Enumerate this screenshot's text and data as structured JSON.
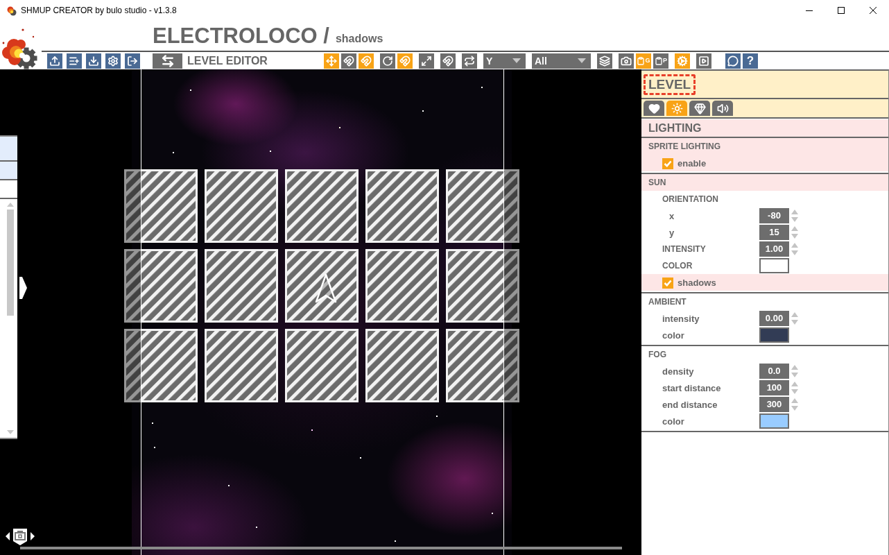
{
  "window": {
    "title": "SHMUP CREATOR by bulo studio - v1.3.8"
  },
  "header": {
    "title": "ELECTROLOCO /",
    "subtitle": "shadows"
  },
  "toolbar": {
    "mode_label": "LEVEL EDITOR",
    "tool_groups": [
      [
        {
          "kind": "button",
          "on": true
        },
        {
          "kind": "button",
          "on": false
        },
        {
          "kind": "button",
          "on": true
        }
      ],
      [
        {
          "kind": "button",
          "on": false
        },
        {
          "kind": "button",
          "on": true
        }
      ],
      [
        {
          "kind": "button",
          "on": false
        }
      ],
      [
        {
          "kind": "button",
          "on": false
        }
      ],
      [
        {
          "kind": "button",
          "on": false
        }
      ],
      [
        {
          "kind": "dropdown",
          "value": "Y"
        }
      ],
      [
        {
          "kind": "dropdown",
          "value": "All"
        }
      ],
      [
        {
          "kind": "button",
          "on": false
        }
      ],
      [
        {
          "kind": "button",
          "on": false
        },
        {
          "kind": "button",
          "on": true,
          "label": "G"
        },
        {
          "kind": "button",
          "on": false,
          "label": "P"
        }
      ],
      [
        {
          "kind": "button",
          "on": true
        }
      ],
      [
        {
          "kind": "button",
          "on": false
        }
      ]
    ],
    "help_label": "?"
  },
  "canvas": {
    "side_list": [
      {
        "selected": true
      },
      {
        "selected": true
      },
      {
        "selected": false
      }
    ]
  },
  "inspector": {
    "title": "LEVEL",
    "tabs": [
      {
        "selected": false
      },
      {
        "selected": true
      },
      {
        "selected": false
      },
      {
        "selected": false
      }
    ],
    "section": "LIGHTING",
    "groups": [
      {
        "title": "SPRITE LIGHTING",
        "highlighted": true,
        "rows": [
          {
            "kind": "checkbox",
            "label": "enable",
            "checked": true
          }
        ]
      },
      {
        "title": "SUN",
        "highlighted": true,
        "rows": [
          {
            "kind": "heading",
            "label": "ORIENTATION",
            "children": [
              {
                "kind": "number",
                "label": "x",
                "value": "-80"
              },
              {
                "kind": "number",
                "label": "y",
                "value": "15"
              }
            ]
          },
          {
            "kind": "number",
            "label": "INTENSITY",
            "value": "1.00"
          },
          {
            "kind": "color",
            "label": "COLOR",
            "color": "#ffffff"
          },
          {
            "kind": "checkbox",
            "label": "shadows",
            "checked": true
          }
        ]
      },
      {
        "title": "AMBIENT",
        "highlighted": false,
        "rows": [
          {
            "kind": "number",
            "label": "intensity",
            "value": "0.00"
          },
          {
            "kind": "color",
            "label": "color",
            "color": "#323c55"
          }
        ]
      },
      {
        "title": "FOG",
        "highlighted": false,
        "rows": [
          {
            "kind": "number",
            "label": "density",
            "value": "0.0"
          },
          {
            "kind": "number",
            "label": "start distance",
            "value": "100"
          },
          {
            "kind": "number",
            "label": "end distance",
            "value": "300"
          },
          {
            "kind": "color",
            "label": "color",
            "color": "#99ccff"
          }
        ]
      }
    ]
  }
}
